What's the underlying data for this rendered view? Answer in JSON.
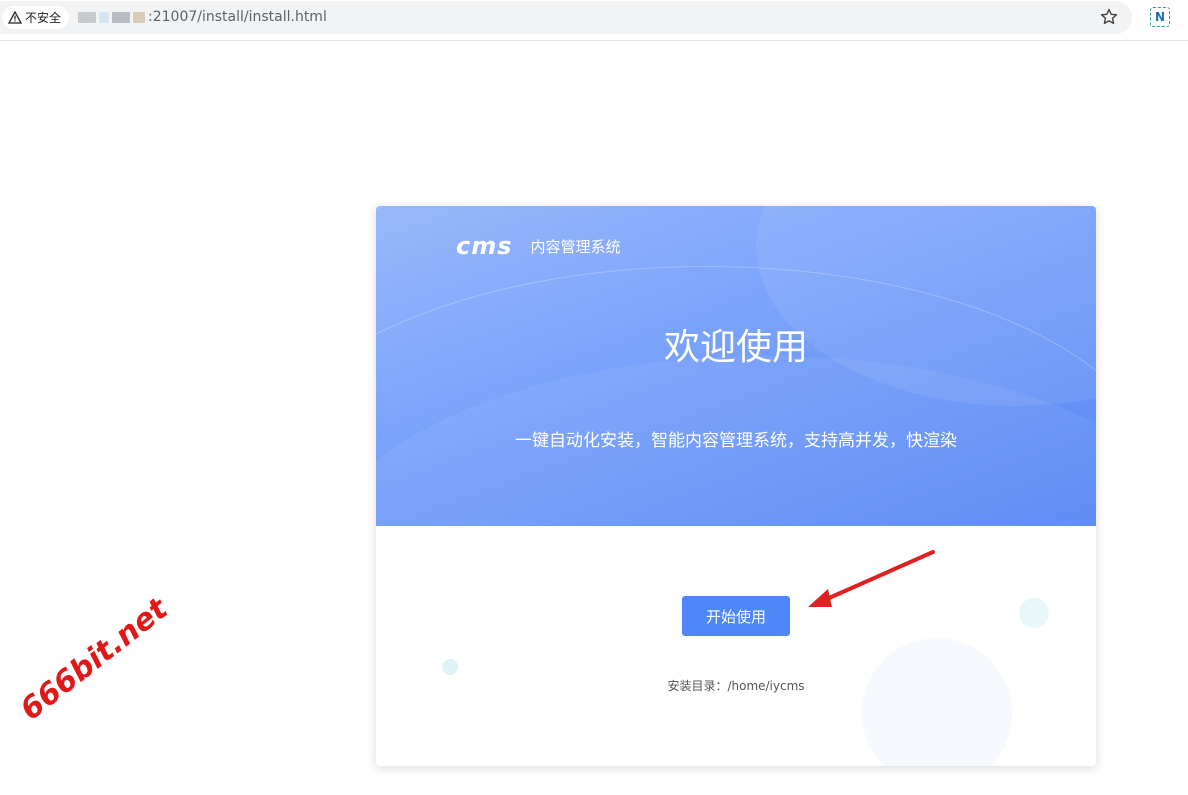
{
  "browser": {
    "security_label": "不安全",
    "url_path": ":21007/install/install.html",
    "extension_letter": "N"
  },
  "app": {
    "logo": "cms",
    "system_name": "内容管理系统",
    "welcome": "欢迎使用",
    "subtitle": "一键自动化安装，智能内容管理系统，支持高并发，快渲染",
    "start_button": "开始使用",
    "install_dir": "安装目录：/home/iycms"
  },
  "watermark": "666bit.net",
  "colors": {
    "accent": "#4e87f6",
    "annotation_arrow": "#e02020"
  }
}
